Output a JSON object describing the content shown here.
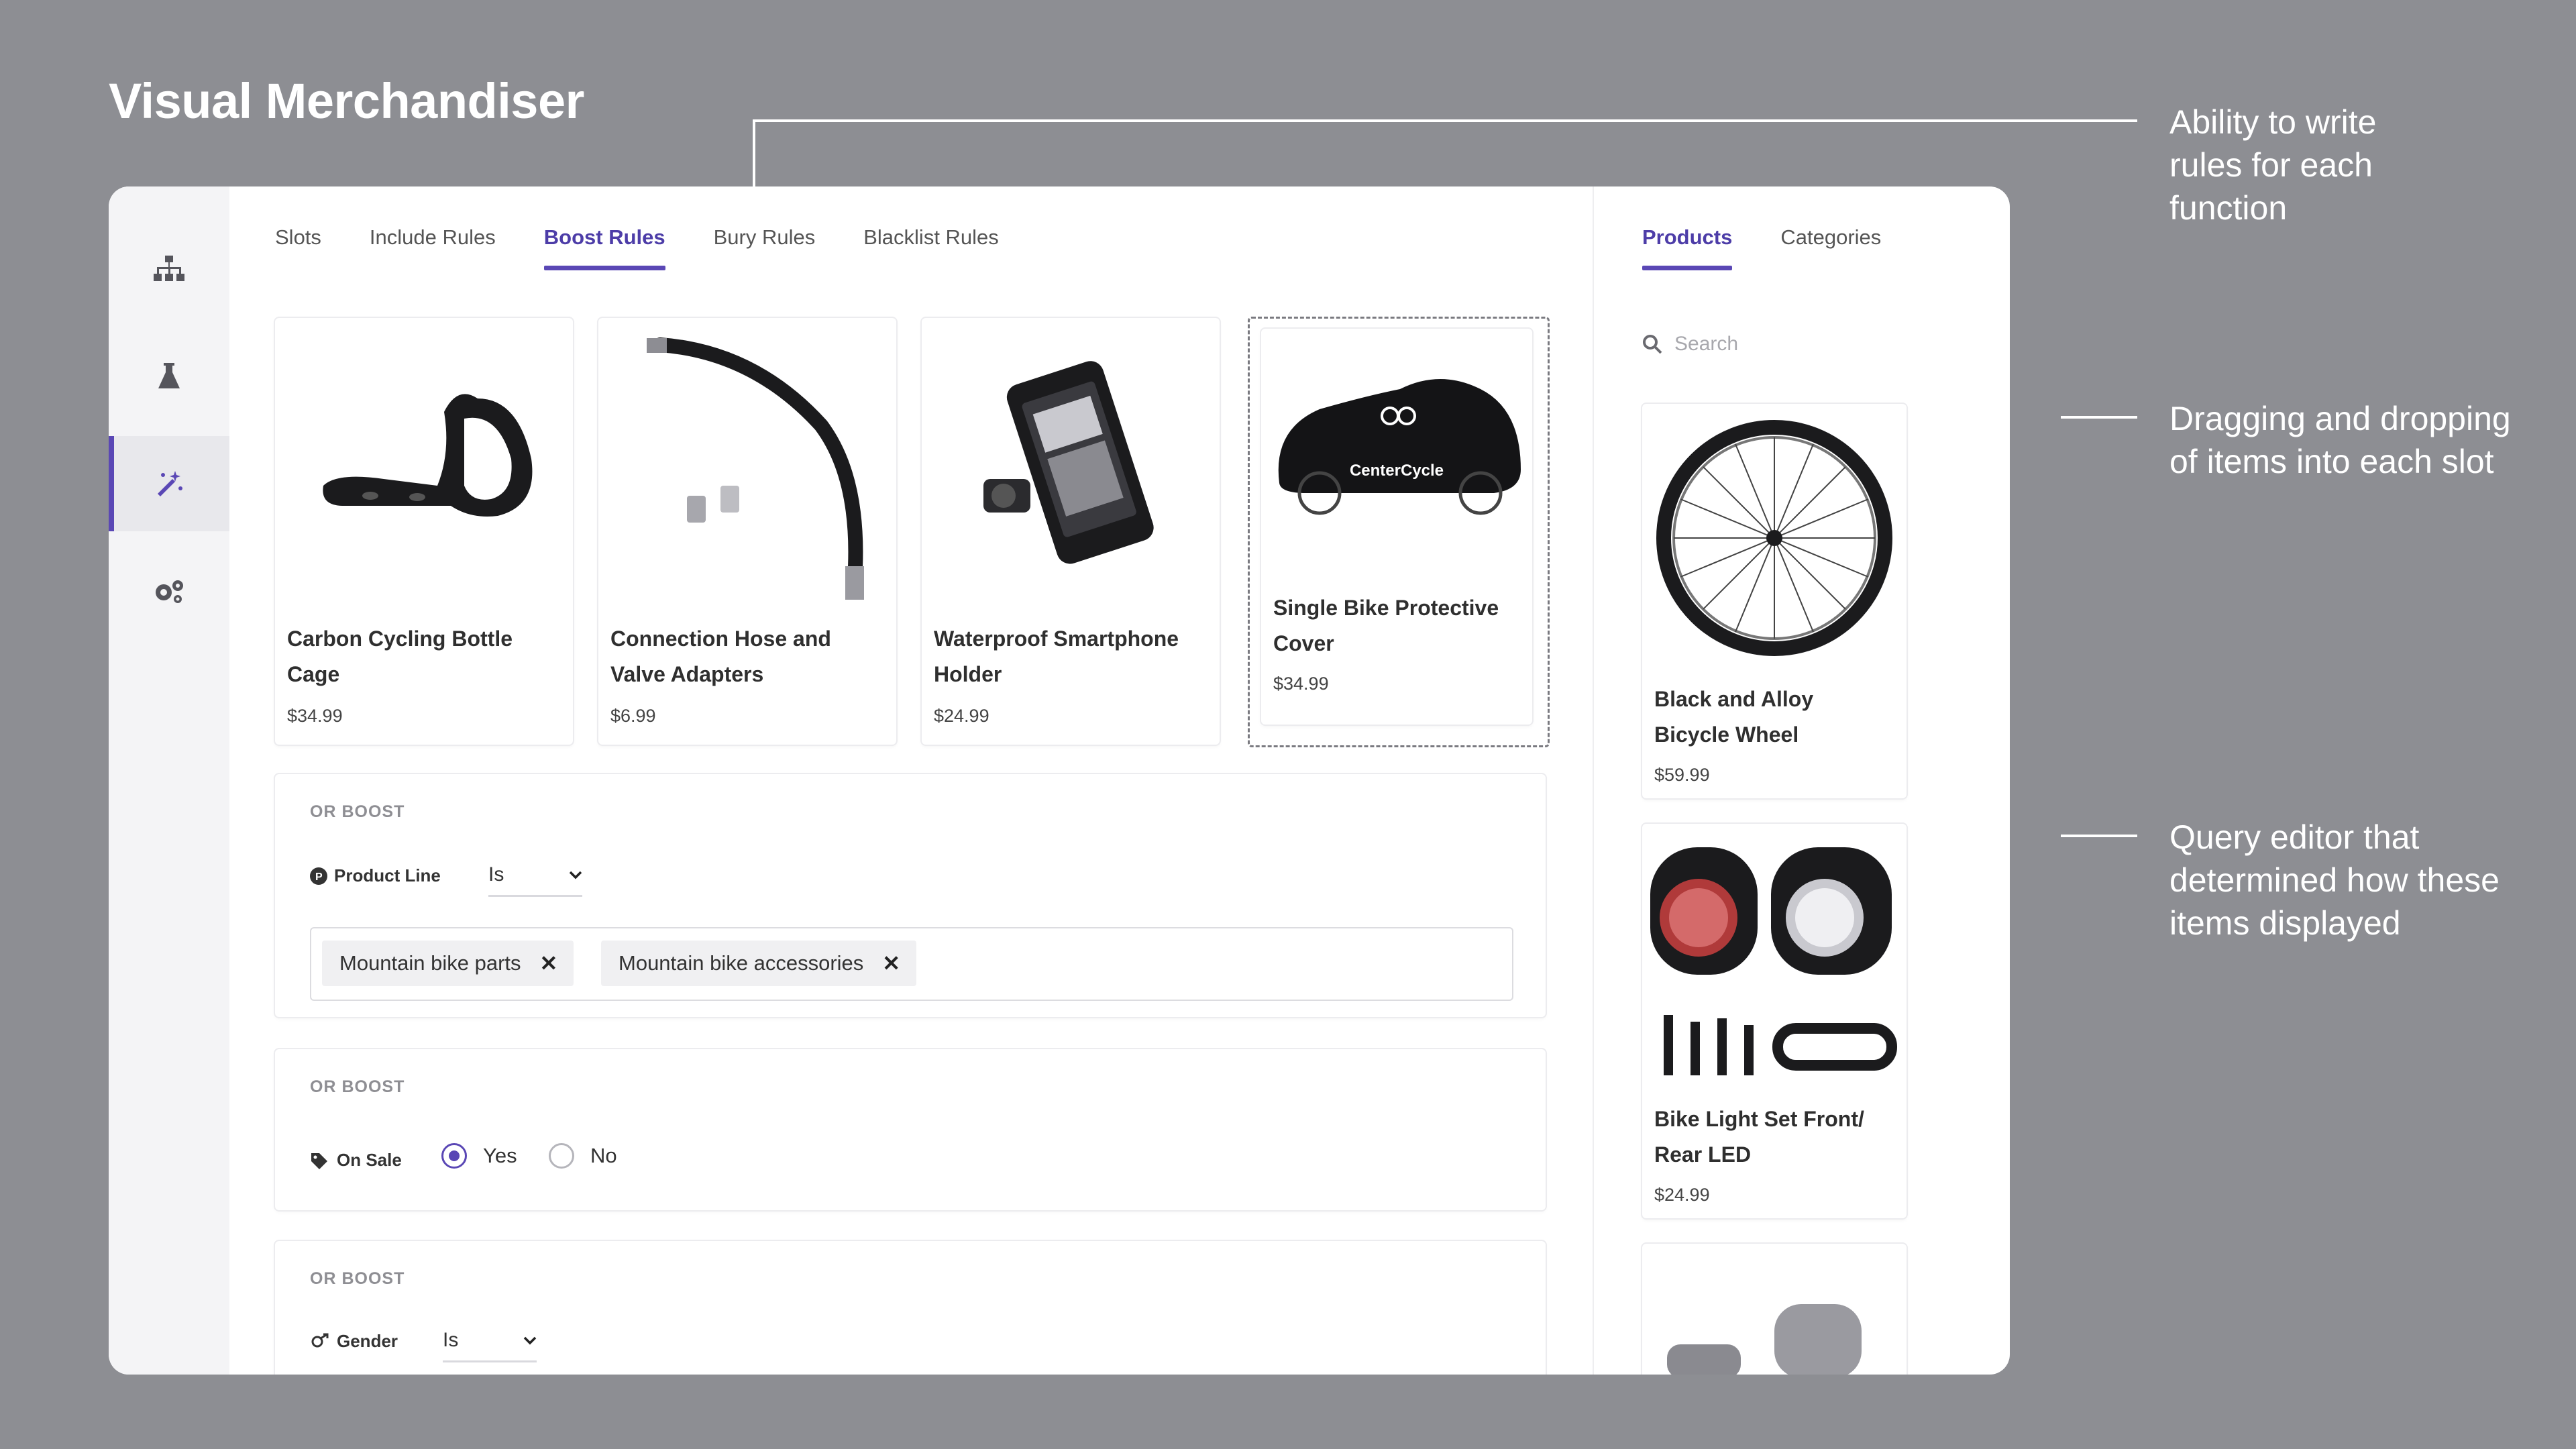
{
  "page_title": "Visual Merchandiser",
  "annotations": [
    "Ability to write rules for each function",
    "Dragging and dropping of items into each slot",
    "Query editor that determined how these items displayed"
  ],
  "sidebar": {
    "items": [
      {
        "icon": "sitemap-icon",
        "active": false
      },
      {
        "icon": "flask-icon",
        "active": false
      },
      {
        "icon": "magic-wand-icon",
        "active": true
      },
      {
        "icon": "gears-icon",
        "active": false
      }
    ]
  },
  "main_tabs": [
    "Slots",
    "Include Rules",
    "Boost Rules",
    "Bury Rules",
    "Blacklist Rules"
  ],
  "main_tab_active": "Boost Rules",
  "slots": [
    {
      "name": "Carbon Cycling Bottle Cage",
      "price": "$34.99"
    },
    {
      "name": "Connection Hose and Valve Adapters",
      "price": "$6.99"
    },
    {
      "name": "Waterproof Smartphone Holder",
      "price": "$24.99"
    },
    {
      "name": "Single Bike Protective Cover",
      "price": "$34.99",
      "brand": "CenterCycle"
    }
  ],
  "rules": [
    {
      "heading": "OR BOOST",
      "field": "Product Line",
      "operator": "Is",
      "tags": [
        "Mountain bike parts",
        "Mountain bike accessories"
      ]
    },
    {
      "heading": "OR BOOST",
      "field": "On Sale",
      "options": [
        "Yes",
        "No"
      ],
      "selected": "Yes"
    },
    {
      "heading": "OR BOOST",
      "field": "Gender",
      "operator": "Is"
    }
  ],
  "right_panel": {
    "tabs": [
      "Products",
      "Categories"
    ],
    "active": "Products",
    "search_placeholder": "Search",
    "products": [
      {
        "name": "Black and Alloy Bicycle Wheel",
        "price": "$59.99"
      },
      {
        "name": "Bike Light Set Front/ Rear LED",
        "price": "$24.99"
      }
    ]
  },
  "colors": {
    "accent": "#5a47b5",
    "background": "#8d8e93"
  }
}
